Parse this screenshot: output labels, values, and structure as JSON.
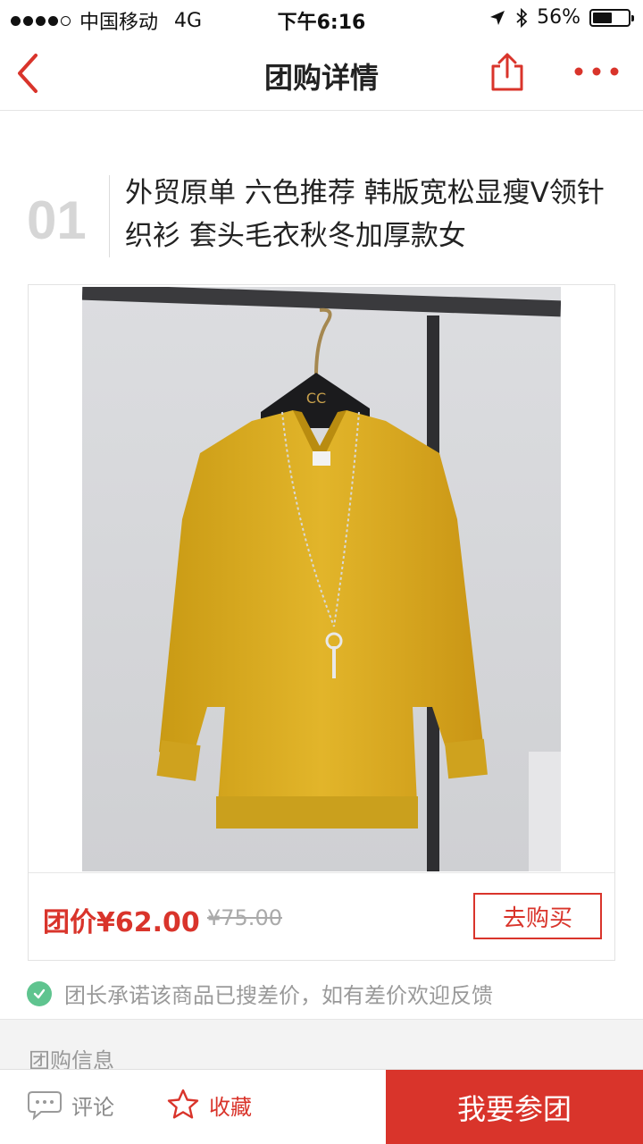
{
  "status_bar": {
    "carrier": "中国移动",
    "network": "4G",
    "time": "下午6:16",
    "battery": "56%",
    "battery_level": 0.56,
    "signal_bars_filled": 4,
    "signal_bars_total": 5
  },
  "nav": {
    "title": "团购详情",
    "back_icon": "chevron-left-icon",
    "share_icon": "share-icon",
    "more_icon": "more-dots-icon"
  },
  "product": {
    "index": "01",
    "title": "外贸原单 六色推荐 韩版宽松显瘦V领针织衫 套头毛衣秋冬加厚款女",
    "group_price_label": "团价¥62.00",
    "original_price": "¥75.00",
    "buy_button": "去购买"
  },
  "promise": {
    "icon": "check-circle-icon",
    "text": "团长承诺该商品已搜差价，如有差价欢迎反馈"
  },
  "section": {
    "title": "团购信息"
  },
  "bottom_bar": {
    "comment_label": "评论",
    "favorite_label": "收藏",
    "join_button": "我要参团"
  },
  "colors": {
    "accent": "#d9342b",
    "check_green": "#5fc48f",
    "muted_text": "#9a9a9a"
  }
}
